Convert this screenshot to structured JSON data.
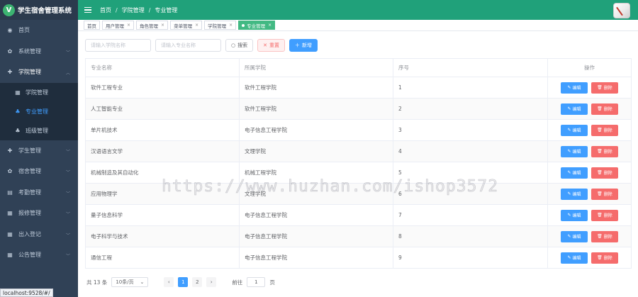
{
  "app": {
    "logo_letter": "V",
    "title": "学生宿舍管理系统"
  },
  "sidebar": {
    "items": [
      {
        "label": "首页",
        "icon": "dashboard-icon",
        "glyph": "◉"
      },
      {
        "label": "系统管理",
        "icon": "gear-icon",
        "glyph": "✿"
      },
      {
        "label": "学院管理",
        "icon": "plus-circle-icon",
        "glyph": "✚"
      }
    ],
    "sub_items": [
      {
        "label": "学院管理",
        "icon": "table-icon",
        "glyph": "▦"
      },
      {
        "label": "专业管理",
        "icon": "tree-icon",
        "glyph": "♣"
      },
      {
        "label": "班级管理",
        "icon": "tree-icon",
        "glyph": "♣"
      }
    ],
    "items_after": [
      {
        "label": "学生管理",
        "icon": "plus-circle-icon",
        "glyph": "✚"
      },
      {
        "label": "宿舍管理",
        "icon": "gear-icon",
        "glyph": "✿"
      },
      {
        "label": "考勤管理",
        "icon": "calendar-icon",
        "glyph": "▤"
      },
      {
        "label": "报修管理",
        "icon": "table-icon",
        "glyph": "▦"
      },
      {
        "label": "出入登记",
        "icon": "table-icon",
        "glyph": "▦"
      },
      {
        "label": "公告管理",
        "icon": "table-icon",
        "glyph": "▦"
      }
    ]
  },
  "statusbar": {
    "url": "localhost:9528/#/"
  },
  "header": {
    "breadcrumb": [
      "首页",
      "学院管理",
      "专业管理"
    ]
  },
  "tags": [
    {
      "label": "首页",
      "closable": false,
      "active": false
    },
    {
      "label": "用户管理",
      "closable": true,
      "active": false
    },
    {
      "label": "角色管理",
      "closable": true,
      "active": false
    },
    {
      "label": "菜单管理",
      "closable": true,
      "active": false
    },
    {
      "label": "学院管理",
      "closable": true,
      "active": false
    },
    {
      "label": "专业管理",
      "closable": true,
      "active": true
    }
  ],
  "search": {
    "college_placeholder": "请输入学院名称",
    "major_placeholder": "请输入专业名称",
    "search_label": "搜索",
    "reset_label": "重置",
    "add_label": "新增"
  },
  "table": {
    "columns": [
      "专业名称",
      "所属学院",
      "序号",
      "操作"
    ],
    "edit_label": "编辑",
    "delete_label": "删除",
    "rows": [
      {
        "major": "软件工程专业",
        "college": "软件工程学院",
        "order": "1"
      },
      {
        "major": "人工智能专业",
        "college": "软件工程学院",
        "order": "2"
      },
      {
        "major": "单片机技术",
        "college": "电子信息工程学院",
        "order": "3"
      },
      {
        "major": "汉语语言文学",
        "college": "文理学院",
        "order": "4"
      },
      {
        "major": "机械制造及其自动化",
        "college": "机械工程学院",
        "order": "5"
      },
      {
        "major": "应用物理学",
        "college": "文理学院",
        "order": "6"
      },
      {
        "major": "量子信息科学",
        "college": "电子信息工程学院",
        "order": "7"
      },
      {
        "major": "电子科学与技术",
        "college": "电子信息工程学院",
        "order": "8"
      },
      {
        "major": "通信工程",
        "college": "电子信息工程学院",
        "order": "9"
      }
    ]
  },
  "pagination": {
    "total": "共 13 条",
    "page_size": "10条/页",
    "pages": [
      "1",
      "2"
    ],
    "current": "1",
    "goto_label": "前往",
    "goto_value": "1",
    "page_unit": "页"
  },
  "watermark": "https://www.huzhan.com/ishop3572",
  "colors": {
    "header": "#20a17a",
    "sidebar": "#304156",
    "primary": "#409eff",
    "danger": "#f56c6c",
    "active_tag": "#42b983"
  }
}
